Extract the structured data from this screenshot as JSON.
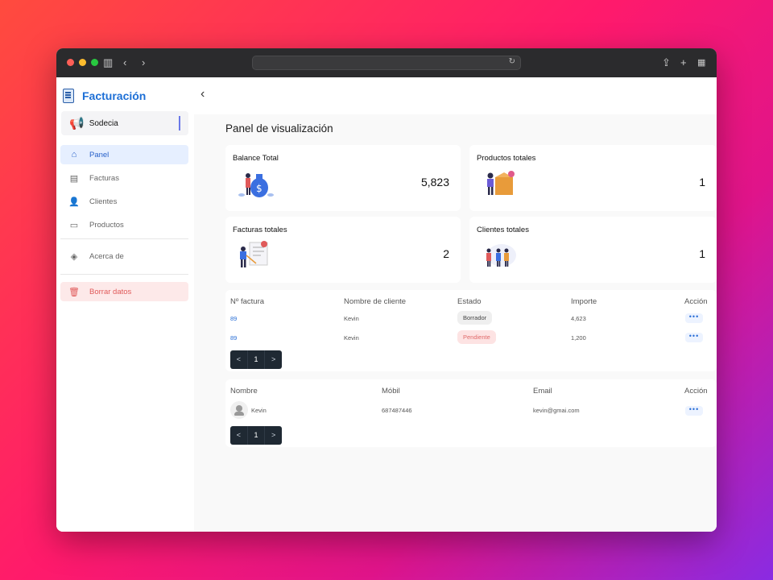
{
  "app": {
    "brand_name": "Facturación",
    "company_name": "Sodecia"
  },
  "sidebar": {
    "items": [
      {
        "label": "Panel",
        "icon": "home-icon"
      },
      {
        "label": "Facturas",
        "icon": "document-icon"
      },
      {
        "label": "Clientes",
        "icon": "user-add-icon"
      },
      {
        "label": "Productos",
        "icon": "archive-icon"
      },
      {
        "label": "Acerca de",
        "icon": "shield-check-icon"
      },
      {
        "label": "Borrar datos",
        "icon": "trash-icon"
      }
    ]
  },
  "main": {
    "title": "Panel de visualización",
    "cards": [
      {
        "title": "Balance Total",
        "value": "5,823"
      },
      {
        "title": "Productos totales",
        "value": "1"
      },
      {
        "title": "Facturas totales",
        "value": "2"
      },
      {
        "title": "Clientes totales",
        "value": "1"
      }
    ],
    "invoices": {
      "headers": [
        "Nº factura",
        "Nombre de cliente",
        "Estado",
        "Importe",
        "Acción"
      ],
      "rows": [
        {
          "number": "89",
          "client": "Kevin",
          "status": "Borrador",
          "amount": "4,623"
        },
        {
          "number": "89",
          "client": "Kevin",
          "status": "Pendiente",
          "amount": "1,200"
        }
      ],
      "pager": {
        "prev": "<",
        "page": "1",
        "next": ">"
      }
    },
    "clients": {
      "headers": [
        "Nombre",
        "Móbil",
        "Email",
        "Acción"
      ],
      "rows": [
        {
          "name": "Kevin",
          "mobile": "687487446",
          "email": "kevin@gmai.com"
        }
      ],
      "pager": {
        "prev": "<",
        "page": "1",
        "next": ">"
      }
    }
  },
  "colors": {
    "brand": "#1d6fd6",
    "active_bg": "#e6efff",
    "danger": "#e05a5a"
  }
}
